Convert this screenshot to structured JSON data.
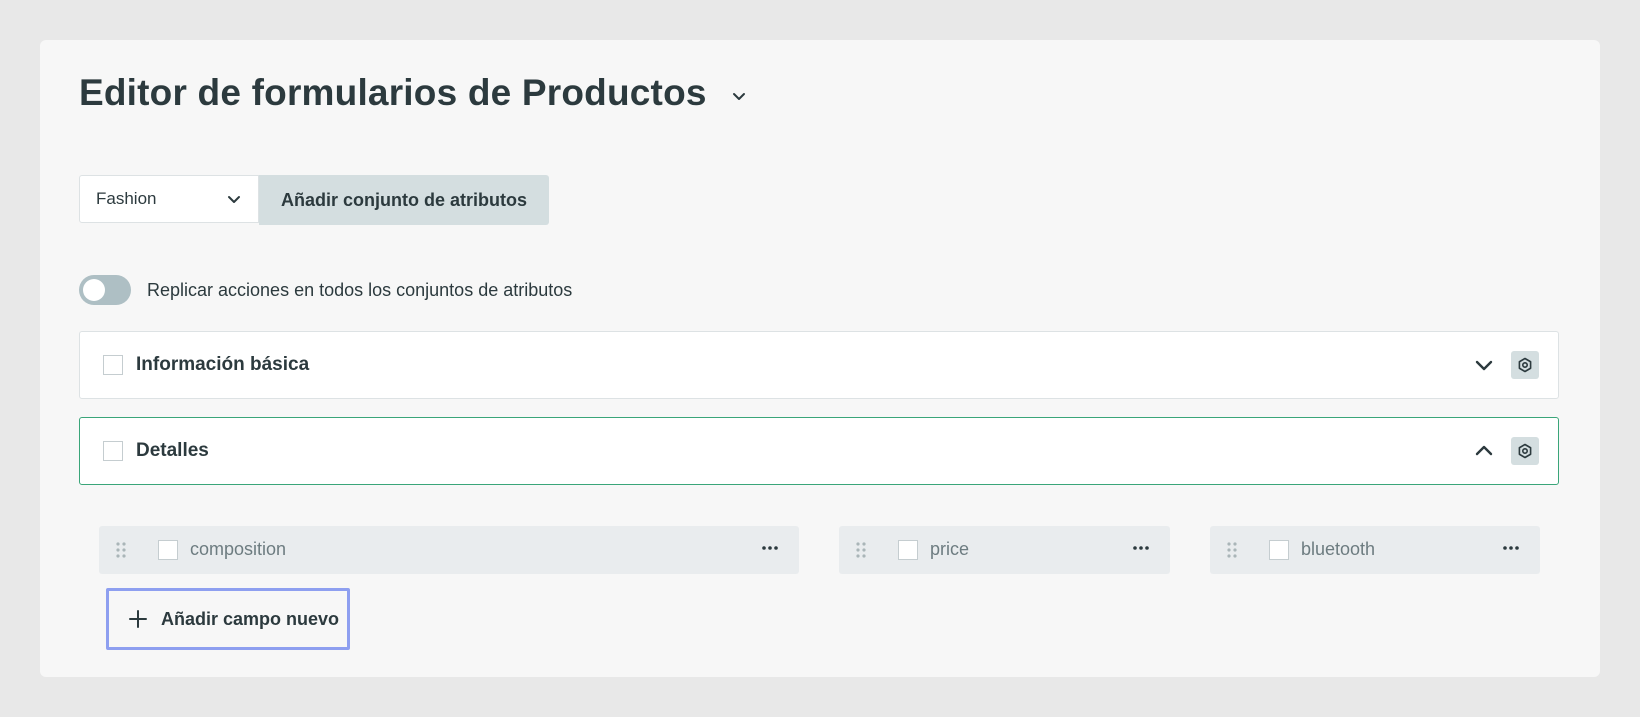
{
  "header": {
    "title": "Editor de formularios de Productos",
    "title_menu_icon": "chevron-down-icon"
  },
  "attribute_set": {
    "selected": "Fashion",
    "add_button_label": "Añadir conjunto de atributos"
  },
  "replicate_toggle": {
    "label": "Replicar acciones en todos los conjuntos de atributos",
    "enabled": false
  },
  "sections": [
    {
      "title": "Información básica",
      "expanded": false,
      "checked": false
    },
    {
      "title": "Detalles",
      "expanded": true,
      "checked": false
    }
  ],
  "fields": [
    {
      "name": "composition",
      "checked": false
    },
    {
      "name": "price",
      "checked": false
    },
    {
      "name": "bluetooth",
      "checked": false
    }
  ],
  "add_field_button": {
    "label": "Añadir campo nuevo"
  },
  "colors": {
    "page_background": "#e8e8e8",
    "card_background": "#f7f7f7",
    "active_border": "#3aa579",
    "focus_outline": "#8e9ff0",
    "button_gray": "#d4dee0",
    "field_background": "#e9ecee"
  }
}
